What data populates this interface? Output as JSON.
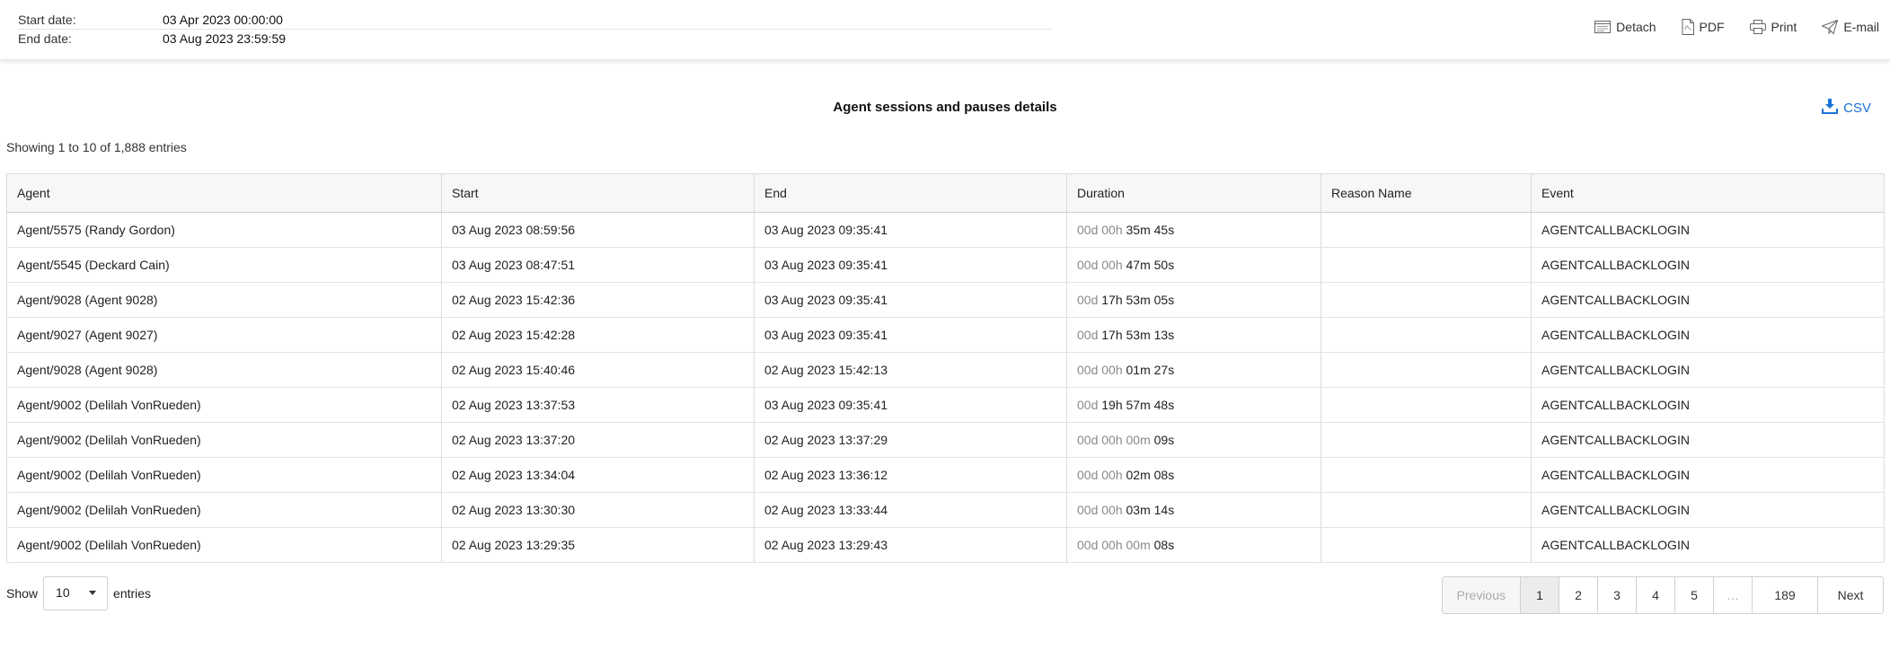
{
  "filters": {
    "start_label": "Start date:",
    "start_value": "03 Apr 2023 00:00:00",
    "end_label": "End date:",
    "end_value": "03 Aug 2023 23:59:59"
  },
  "actions": {
    "detach": "Detach",
    "pdf": "PDF",
    "print": "Print",
    "email": "E-mail"
  },
  "report": {
    "title": "Agent sessions and pauses details",
    "csv_label": "CSV",
    "info": "Showing 1 to 10 of 1,888 entries"
  },
  "table": {
    "columns": [
      "Agent",
      "Start",
      "End",
      "Duration",
      "Reason Name",
      "Event"
    ],
    "rows": [
      {
        "agent": "Agent/5575 (Randy Gordon)",
        "start": "03 Aug 2023 08:59:56",
        "end": "03 Aug 2023 09:35:41",
        "duration_muted": "00d 00h",
        "duration_value": "35m 45s",
        "reason": "",
        "event": "AGENTCALLBACKLOGIN"
      },
      {
        "agent": "Agent/5545 (Deckard Cain)",
        "start": "03 Aug 2023 08:47:51",
        "end": "03 Aug 2023 09:35:41",
        "duration_muted": "00d 00h",
        "duration_value": "47m 50s",
        "reason": "",
        "event": "AGENTCALLBACKLOGIN"
      },
      {
        "agent": "Agent/9028 (Agent 9028)",
        "start": "02 Aug 2023 15:42:36",
        "end": "03 Aug 2023 09:35:41",
        "duration_muted": "00d",
        "duration_value": "17h 53m 05s",
        "reason": "",
        "event": "AGENTCALLBACKLOGIN"
      },
      {
        "agent": "Agent/9027 (Agent 9027)",
        "start": "02 Aug 2023 15:42:28",
        "end": "03 Aug 2023 09:35:41",
        "duration_muted": "00d",
        "duration_value": "17h 53m 13s",
        "reason": "",
        "event": "AGENTCALLBACKLOGIN"
      },
      {
        "agent": "Agent/9028 (Agent 9028)",
        "start": "02 Aug 2023 15:40:46",
        "end": "02 Aug 2023 15:42:13",
        "duration_muted": "00d 00h",
        "duration_value": "01m 27s",
        "reason": "",
        "event": "AGENTCALLBACKLOGIN"
      },
      {
        "agent": "Agent/9002 (Delilah VonRueden)",
        "start": "02 Aug 2023 13:37:53",
        "end": "03 Aug 2023 09:35:41",
        "duration_muted": "00d",
        "duration_value": "19h 57m 48s",
        "reason": "",
        "event": "AGENTCALLBACKLOGIN"
      },
      {
        "agent": "Agent/9002 (Delilah VonRueden)",
        "start": "02 Aug 2023 13:37:20",
        "end": "02 Aug 2023 13:37:29",
        "duration_muted": "00d 00h 00m",
        "duration_value": "09s",
        "reason": "",
        "event": "AGENTCALLBACKLOGIN"
      },
      {
        "agent": "Agent/9002 (Delilah VonRueden)",
        "start": "02 Aug 2023 13:34:04",
        "end": "02 Aug 2023 13:36:12",
        "duration_muted": "00d 00h",
        "duration_value": "02m 08s",
        "reason": "",
        "event": "AGENTCALLBACKLOGIN"
      },
      {
        "agent": "Agent/9002 (Delilah VonRueden)",
        "start": "02 Aug 2023 13:30:30",
        "end": "02 Aug 2023 13:33:44",
        "duration_muted": "00d 00h",
        "duration_value": "03m 14s",
        "reason": "",
        "event": "AGENTCALLBACKLOGIN"
      },
      {
        "agent": "Agent/9002 (Delilah VonRueden)",
        "start": "02 Aug 2023 13:29:35",
        "end": "02 Aug 2023 13:29:43",
        "duration_muted": "00d 00h 00m",
        "duration_value": "08s",
        "reason": "",
        "event": "AGENTCALLBACKLOGIN"
      }
    ]
  },
  "length_menu": {
    "prefix": "Show",
    "value": "10",
    "suffix": "entries"
  },
  "pagination": {
    "previous": "Previous",
    "pages": [
      "1",
      "2",
      "3",
      "4",
      "5"
    ],
    "current": "1",
    "ellipsis": "…",
    "last": "189",
    "next": "Next"
  },
  "colors": {
    "accent": "#1a73d9",
    "muted_text": "#8a8a8a"
  },
  "icons": [
    "detach-icon",
    "pdf-icon",
    "print-icon",
    "email-icon",
    "download-icon"
  ]
}
